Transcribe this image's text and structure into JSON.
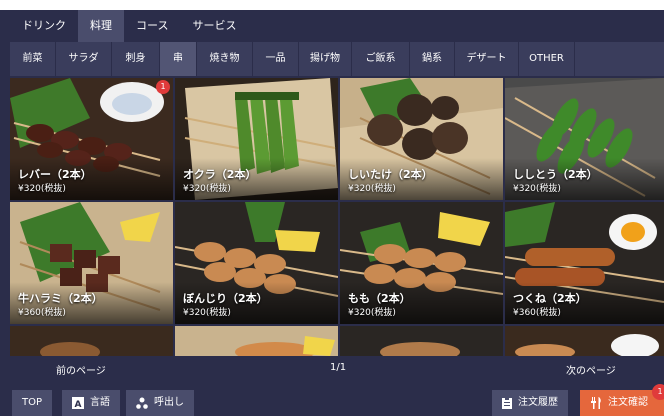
{
  "categories": [
    {
      "label": "ドリンク",
      "active": false
    },
    {
      "label": "料理",
      "active": true
    },
    {
      "label": "コース",
      "active": false
    },
    {
      "label": "サービス",
      "active": false
    }
  ],
  "subcategories": [
    {
      "label": "前菜",
      "active": false
    },
    {
      "label": "サラダ",
      "active": false
    },
    {
      "label": "刺身",
      "active": false
    },
    {
      "label": "串",
      "active": true
    },
    {
      "label": "焼き物",
      "active": false
    },
    {
      "label": "一品",
      "active": false
    },
    {
      "label": "揚げ物",
      "active": false
    },
    {
      "label": "ご飯系",
      "active": false
    },
    {
      "label": "鍋系",
      "active": false
    },
    {
      "label": "デザート",
      "active": false
    },
    {
      "label": "OTHER",
      "active": false
    }
  ],
  "menu_items": [
    {
      "name": "レバー（2本）",
      "price": "¥320(税抜)",
      "badge": "1"
    },
    {
      "name": "オクラ（2本）",
      "price": "¥320(税抜)"
    },
    {
      "name": "しいたけ（2本）",
      "price": "¥320(税抜)"
    },
    {
      "name": "ししとう（2本）",
      "price": "¥320(税抜)"
    },
    {
      "name": "牛ハラミ（2本）",
      "price": "¥360(税抜)"
    },
    {
      "name": "ぼんじり（2本）",
      "price": "¥320(税抜)"
    },
    {
      "name": "もも（2本）",
      "price": "¥320(税抜)"
    },
    {
      "name": "つくね（2本）",
      "price": "¥360(税抜)"
    }
  ],
  "pager": {
    "prev_label": "前のページ",
    "page_indicator": "1/1",
    "next_label": "次のページ"
  },
  "bottom_bar": {
    "top_label": "TOP",
    "language_label": "言語",
    "call_label": "呼出し",
    "history_label": "注文履歴",
    "confirm_label": "注文確認",
    "confirm_badge": "1"
  },
  "colors": {
    "background": "#2b2d4a",
    "tab_active": "#4a4d6c",
    "accent_order": "#e5673c",
    "badge": "#e03b3b"
  }
}
